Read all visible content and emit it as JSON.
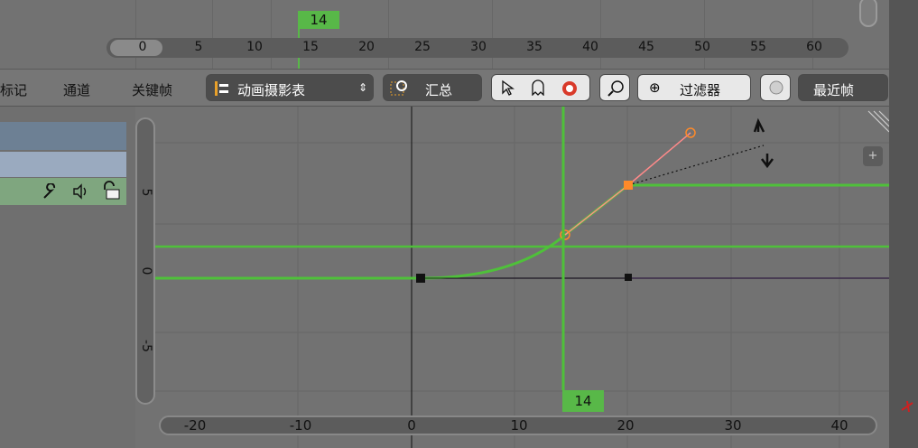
{
  "top_timeline": {
    "current_frame": "14",
    "ticks": [
      "0",
      "5",
      "10",
      "15",
      "20",
      "25",
      "30",
      "35",
      "40",
      "45",
      "50",
      "55",
      "60"
    ]
  },
  "header": {
    "menu": [
      "标记",
      "通道",
      "关键帧"
    ],
    "editor_type": "动画摄影表",
    "summary_label": "汇总",
    "filter_label": "过滤器",
    "recent_label": "最近帧"
  },
  "graph": {
    "current_frame": "14",
    "x_ticks": [
      "-20",
      "-10",
      "0",
      "10",
      "20",
      "30",
      "40"
    ],
    "y_ticks": [
      "5",
      "0",
      "-5"
    ],
    "curve_color": "#4fc03a",
    "keyframe_color": "#111111",
    "selected_handle_color": "#ff8a2a"
  }
}
